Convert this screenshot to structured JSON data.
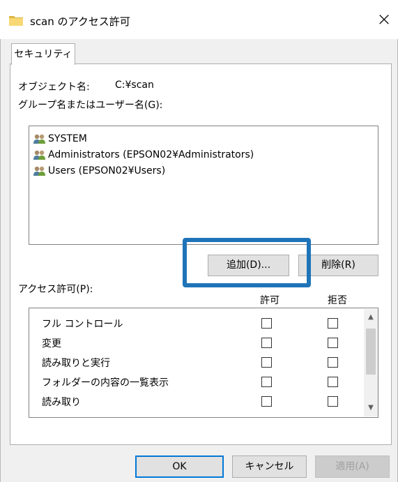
{
  "window": {
    "title": "scan のアクセス許可",
    "close_glyph": "×"
  },
  "tabs": [
    {
      "label": "セキュリティ"
    }
  ],
  "object": {
    "label": "オブジェクト名:",
    "value": "C:¥scan"
  },
  "group": {
    "label": "グループ名またはユーザー名(G):",
    "items": [
      {
        "name": "SYSTEM",
        "icon": "users-icon"
      },
      {
        "name": "Administrators (EPSON02¥Administrators)",
        "icon": "users-icon"
      },
      {
        "name": "Users (EPSON02¥Users)",
        "icon": "users-icon"
      }
    ]
  },
  "buttons": {
    "add": "追加(D)...",
    "remove": "削除(R)",
    "ok": "OK",
    "cancel": "キャンセル",
    "apply": "適用(A)"
  },
  "permissions": {
    "label": "アクセス許可(P):",
    "col_allow": "許可",
    "col_deny": "拒否",
    "rows": [
      {
        "name": "フル コントロール",
        "allow": false,
        "deny": false
      },
      {
        "name": "変更",
        "allow": false,
        "deny": false
      },
      {
        "name": "読み取りと実行",
        "allow": false,
        "deny": false
      },
      {
        "name": "フォルダーの内容の一覧表示",
        "allow": false,
        "deny": false
      },
      {
        "name": "読み取り",
        "allow": false,
        "deny": false
      }
    ]
  },
  "colors": {
    "highlight": "#1f74b8",
    "ok_border": "#0078d7",
    "folder": "#f8d775"
  }
}
